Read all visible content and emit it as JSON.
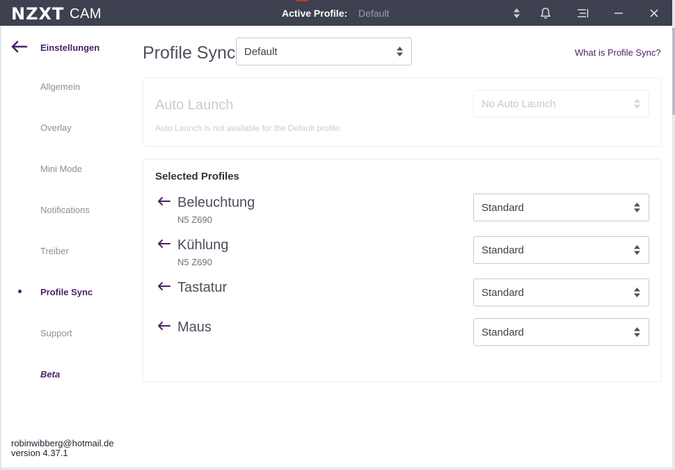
{
  "titlebar": {
    "brand": "NZXT",
    "product": "CAM",
    "active_profile_label": "Active Profile:",
    "active_profile_value": "Default"
  },
  "sidebar": {
    "header": "Einstellungen",
    "items": [
      {
        "label": "Allgemein"
      },
      {
        "label": "Overlay"
      },
      {
        "label": "Mini Mode"
      },
      {
        "label": "Notifications"
      },
      {
        "label": "Treiber"
      },
      {
        "label": "Profile Sync",
        "active": true
      },
      {
        "label": "Support"
      },
      {
        "label": "Beta"
      }
    ],
    "user_email": "robinwibberg@hotmail.de",
    "version": "version 4.37.1"
  },
  "main": {
    "title": "Profile Sync",
    "profile_select_value": "Default",
    "help_link": "What is Profile Sync?",
    "auto_launch": {
      "title": "Auto Launch",
      "description": "Auto Launch is not available for the Default profile.",
      "select_value": "No Auto Launch"
    },
    "selected_profiles": {
      "title": "Selected Profiles",
      "rows": [
        {
          "name": "Beleuchtung",
          "device": "N5 Z690",
          "value": "Standard"
        },
        {
          "name": "Kühlung",
          "device": "N5 Z690",
          "value": "Standard"
        },
        {
          "name": "Tastatur",
          "device": "",
          "value": "Standard"
        },
        {
          "name": "Maus",
          "device": "",
          "value": "Standard"
        }
      ]
    }
  },
  "colors": {
    "titlebar_bg": "#3d4150",
    "accent_purple": "#4a1f6b",
    "muted_text": "#8a8e98"
  }
}
